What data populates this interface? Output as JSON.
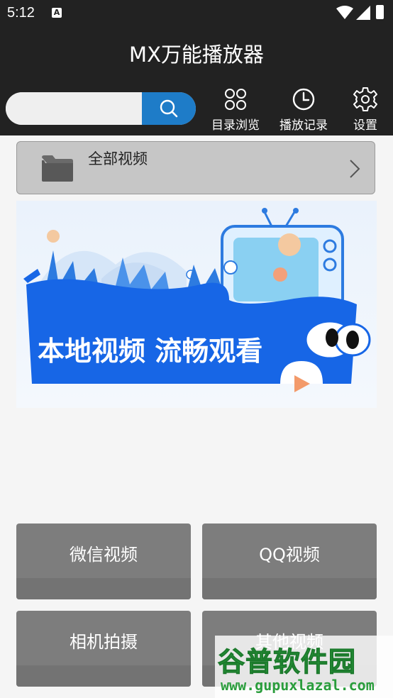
{
  "status": {
    "time": "5:12",
    "a_icon": "A"
  },
  "app": {
    "title": "MX万能播放器"
  },
  "search": {
    "placeholder": "",
    "value": ""
  },
  "toolbar": [
    {
      "label": "目录浏览",
      "icon": "grid-icon"
    },
    {
      "label": "播放记录",
      "icon": "clock-icon"
    },
    {
      "label": "设置",
      "icon": "gear-icon"
    }
  ],
  "all_videos": {
    "label": "全部视频"
  },
  "banner": {
    "headline": "本地视频 流畅观看"
  },
  "categories": [
    {
      "label": "微信视频"
    },
    {
      "label": "QQ视频"
    },
    {
      "label": "相机拍摄"
    },
    {
      "label": "其他视频"
    }
  ],
  "watermark": {
    "brand": "谷普软件园",
    "url": "www.gupuxlazal.com"
  },
  "colors": {
    "bar": "#222222",
    "accent": "#1e7cc8",
    "button": "#7d7d7d"
  }
}
